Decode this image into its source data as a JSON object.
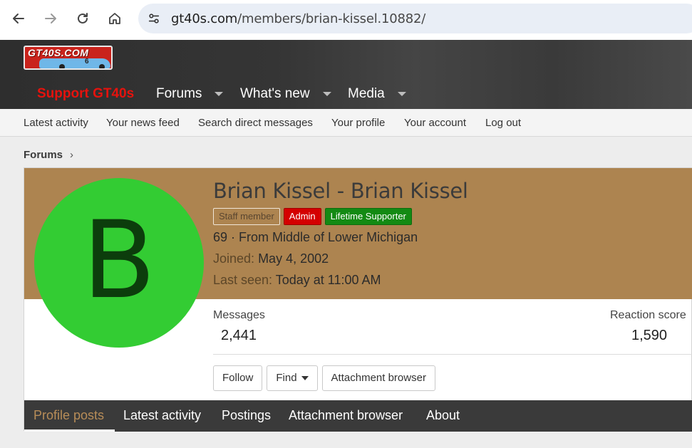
{
  "browser": {
    "url_host": "gt40s.com",
    "url_path": "/members/brian-kissel.10882/"
  },
  "logo": {
    "text": "GT40S.COM",
    "number": "6"
  },
  "main_nav": {
    "support": "Support GT40s",
    "items": [
      {
        "label": "Forums"
      },
      {
        "label": "What's new"
      },
      {
        "label": "Media"
      }
    ]
  },
  "sub_nav": [
    "Latest activity",
    "Your news feed",
    "Search direct messages",
    "Your profile",
    "Your account",
    "Log out"
  ],
  "breadcrumb": {
    "label": "Forums"
  },
  "profile": {
    "avatar_letter": "B",
    "name": "Brian Kissel - Brian Kissel",
    "badges": [
      "Staff member",
      "Admin",
      "Lifetime Supporter"
    ],
    "location": "69 · From Middle of Lower Michigan",
    "joined_label": "Joined:",
    "joined_value": "May 4, 2002",
    "last_seen_label": "Last seen:",
    "last_seen_value": "Today at 11:00 AM",
    "messages_label": "Messages",
    "messages_value": "2,441",
    "reaction_label": "Reaction score",
    "reaction_value": "1,590"
  },
  "actions": {
    "follow": "Follow",
    "find": "Find",
    "attachments": "Attachment browser"
  },
  "tabs": [
    "Profile posts",
    "Latest activity",
    "Postings",
    "Attachment browser",
    "About"
  ],
  "colors": {
    "banner": "#ad8450",
    "avatar_bg": "#33cc33",
    "support": "#e6120d",
    "admin": "#d40000",
    "lifetime": "#138a13",
    "tab_active": "#b88d58"
  },
  "icons": {
    "back": "arrow-left-icon",
    "forward": "arrow-right-icon",
    "reload": "reload-icon",
    "home": "home-icon",
    "site_info": "tune-icon"
  }
}
